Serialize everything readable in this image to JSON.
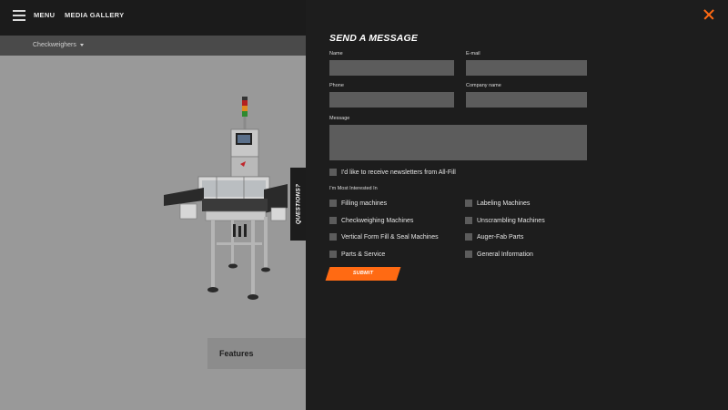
{
  "nav": {
    "menu_label": "MENU",
    "gallery_label": "MEDIA GALLERY"
  },
  "product_selector": {
    "selected": "Checkweighers"
  },
  "product": {
    "features_label": "Features",
    "questions_tab": "QUESTIONS?"
  },
  "form": {
    "title": "SEND A MESSAGE",
    "fields": {
      "name_label": "Name",
      "email_label": "E-mail",
      "phone_label": "Phone",
      "company_label": "Company name",
      "message_label": "Message"
    },
    "newsletter_label": "I'd like to receive newsletters from All-Fill",
    "interests_heading": "I'm Most Interested In",
    "interests_left": [
      "Filling machines",
      "Checkweighing Machines",
      "Vertical Form Fill & Seal Machines",
      "Parts & Service"
    ],
    "interests_right": [
      "Labeling Machines",
      "Unscrambling Machines",
      "Auger-Fab Parts",
      "General Information"
    ],
    "submit_label": "SUBMIT"
  },
  "colors": {
    "accent": "#ff6a13",
    "panel_bg": "#1d1d1d",
    "input_bg": "#5c5c5c",
    "product_bg": "#999999"
  },
  "icons": {
    "menu": "hamburger-icon",
    "close": "close-icon",
    "dropdown": "chevron-down-icon"
  }
}
